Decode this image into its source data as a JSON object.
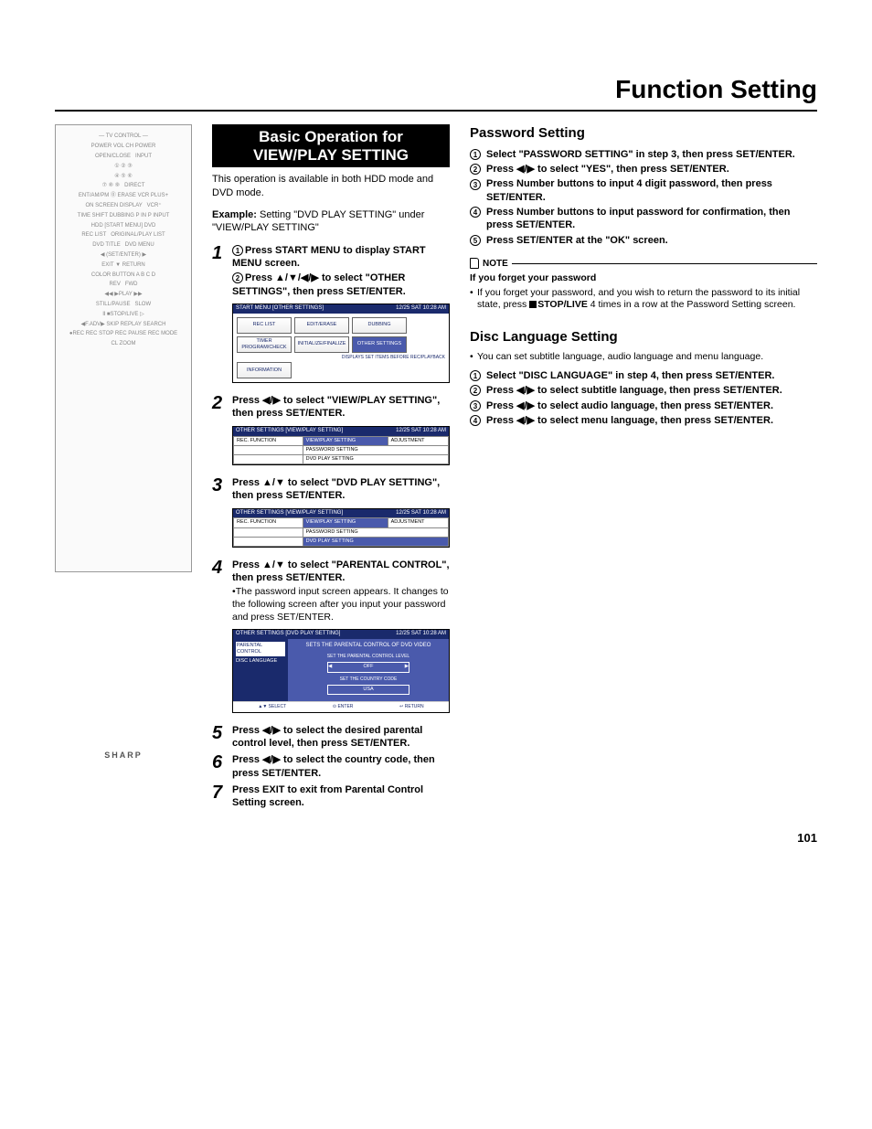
{
  "page_title": "Function Setting",
  "page_number": "101",
  "remote": {
    "brand": "SHARP"
  },
  "mid": {
    "banner": "Basic Operation for VIEW/PLAY SETTING",
    "intro": "This operation is available in both HDD mode and DVD mode.",
    "example_label": "Example:",
    "example_text": " Setting \"DVD PLAY SETTING\" under \"VIEW/PLAY SETTING\"",
    "steps": {
      "s1a": "Press START MENU to display START MENU screen.",
      "s1b": "Press ▲/▼/◀/▶ to select \"OTHER SETTINGS\", then press SET/ENTER.",
      "s2": "Press ◀/▶ to select \"VIEW/PLAY SETTING\", then press SET/ENTER.",
      "s3": "Press ▲/▼ to select \"DVD PLAY SETTING\", then press SET/ENTER.",
      "s4": "Press ▲/▼ to select \"PARENTAL CONTROL\", then press SET/ENTER.",
      "s4_sub": "The password input screen appears. It changes to the following screen after you input your password and press SET/ENTER.",
      "s5": "Press ◀/▶ to select the desired parental control level, then press SET/ENTER.",
      "s6": "Press ◀/▶ to select the country code, then press SET/ENTER.",
      "s7": "Press EXIT to exit from Parental Control Setting screen."
    },
    "osd1": {
      "title": "START MENU [OTHER SETTINGS]",
      "time": "12/25 SAT 10:28 AM",
      "btns": [
        "REC LIST",
        "EDIT/ERASE",
        "DUBBING",
        "TIMER PROGRAM/CHECK",
        "INITIALIZE/FINALIZE",
        "OTHER SETTINGS",
        "INFORMATION"
      ],
      "hint": "DISPLAYS SET ITEMS BEFORE REC/PLAYBACK"
    },
    "osd2": {
      "title": "OTHER SETTINGS [VIEW/PLAY SETTING]",
      "time": "12/25 SAT 10:28 AM",
      "left": "REC. FUNCTION",
      "tab": "VIEW/PLAY SETTING",
      "tab2": "ADJUSTMENT",
      "rows": [
        "PASSWORD SETTING",
        "DVD PLAY SETTING"
      ]
    },
    "osd3": {
      "title": "OTHER SETTINGS [VIEW/PLAY SETTING]",
      "time": "12/25 SAT 10:28 AM",
      "left": "REC. FUNCTION",
      "tab": "VIEW/PLAY SETTING",
      "tab2": "ADJUSTMENT",
      "rows": [
        "PASSWORD SETTING",
        "DVD PLAY SETTING"
      ]
    },
    "osd4": {
      "title": "OTHER SETTINGS [DVD PLAY SETTING]",
      "time": "12/25 SAT 10:28 AM",
      "left": [
        "PARENTAL CONTROL",
        "DISC LANGUAGE"
      ],
      "desc": "SETS THE PARENTAL CONTROL OF DVD VIDEO",
      "lbl1": "SET THE PARENTAL CONTROL LEVEL",
      "val1": "OFF",
      "lbl2": "SET THE COUNTRY CODE",
      "val2": "USA",
      "foot": [
        "SELECT",
        "ENTER",
        "RETURN"
      ]
    }
  },
  "right": {
    "pw_title": "Password Setting",
    "pw": {
      "i1": "Select \"PASSWORD SETTING\" in step 3, then press SET/ENTER.",
      "i2": "Press ◀/▶ to select \"YES\", then press SET/ENTER.",
      "i3": "Press Number buttons to input 4 digit password, then press SET/ENTER.",
      "i4": "Press Number buttons to input password for confirmation, then press SET/ENTER.",
      "i5": "Press SET/ENTER at the \"OK\" screen."
    },
    "note_label": "NOTE",
    "note_sub": "If you forget your password",
    "note_body": "If you forget your password, and you wish to return the password to its initial state, press ",
    "note_stop": "STOP/LIVE",
    "note_body2": " 4 times in a row at the Password Setting screen.",
    "disc_title": "Disc Language Setting",
    "disc_intro": "You can set subtitle language, audio language and menu language.",
    "disc": {
      "i1": "Select \"DISC LANGUAGE\" in step 4, then press SET/ENTER.",
      "i2": "Press ◀/▶ to select subtitle language, then press SET/ENTER.",
      "i3": "Press ◀/▶ to select audio language, then press SET/ENTER.",
      "i4": "Press ◀/▶ to select menu language, then press SET/ENTER."
    }
  }
}
